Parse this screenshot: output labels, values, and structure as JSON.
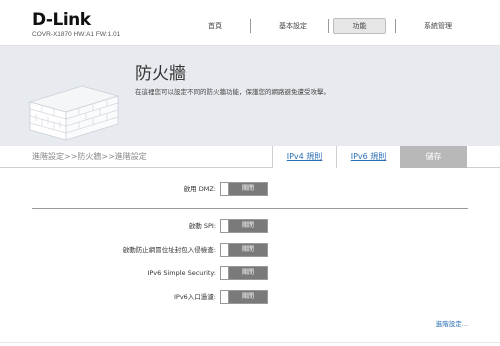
{
  "brand": {
    "logo": "D-Link",
    "model_line": "COVR-X1870 HW:A1 FW:1.01"
  },
  "nav": {
    "items": [
      {
        "label": "首頁"
      },
      {
        "label": "基本設定"
      },
      {
        "label": "功能"
      },
      {
        "label": "系統管理"
      }
    ],
    "active_index": 2
  },
  "banner": {
    "title": "防火牆",
    "description": "在這裡您可以設定不同的防火牆功能，保護您的網路避免遭受攻擊。"
  },
  "toolbar": {
    "breadcrumb": "進階設定>>防火牆>>進階設定",
    "ipv4_rules_label": "IPv4 規則",
    "ipv6_rules_label": "IPv6 規則",
    "save_label": "儲存"
  },
  "settings": {
    "dmz": {
      "label": "啟用 DMZ:",
      "state": "關閉"
    },
    "spi": {
      "label": "啟動 SPI:",
      "state": "關閉"
    },
    "anti_spoof": {
      "label": "啟動防止網冒位址封包入侵檢查:",
      "state": "關閉"
    },
    "ipv6_simple": {
      "label": "IPv6 Simple Security:",
      "state": "關閉"
    },
    "ipv6_ingress": {
      "label": "IPv6入口過濾:",
      "state": "關閉"
    }
  },
  "advanced_link": "進階設定...",
  "colors": {
    "accent": "#2a6fb4",
    "banner_bg": "#e7ebef",
    "toggle_off": "#7a7a7a",
    "save_disabled": "#b8b8b8"
  }
}
